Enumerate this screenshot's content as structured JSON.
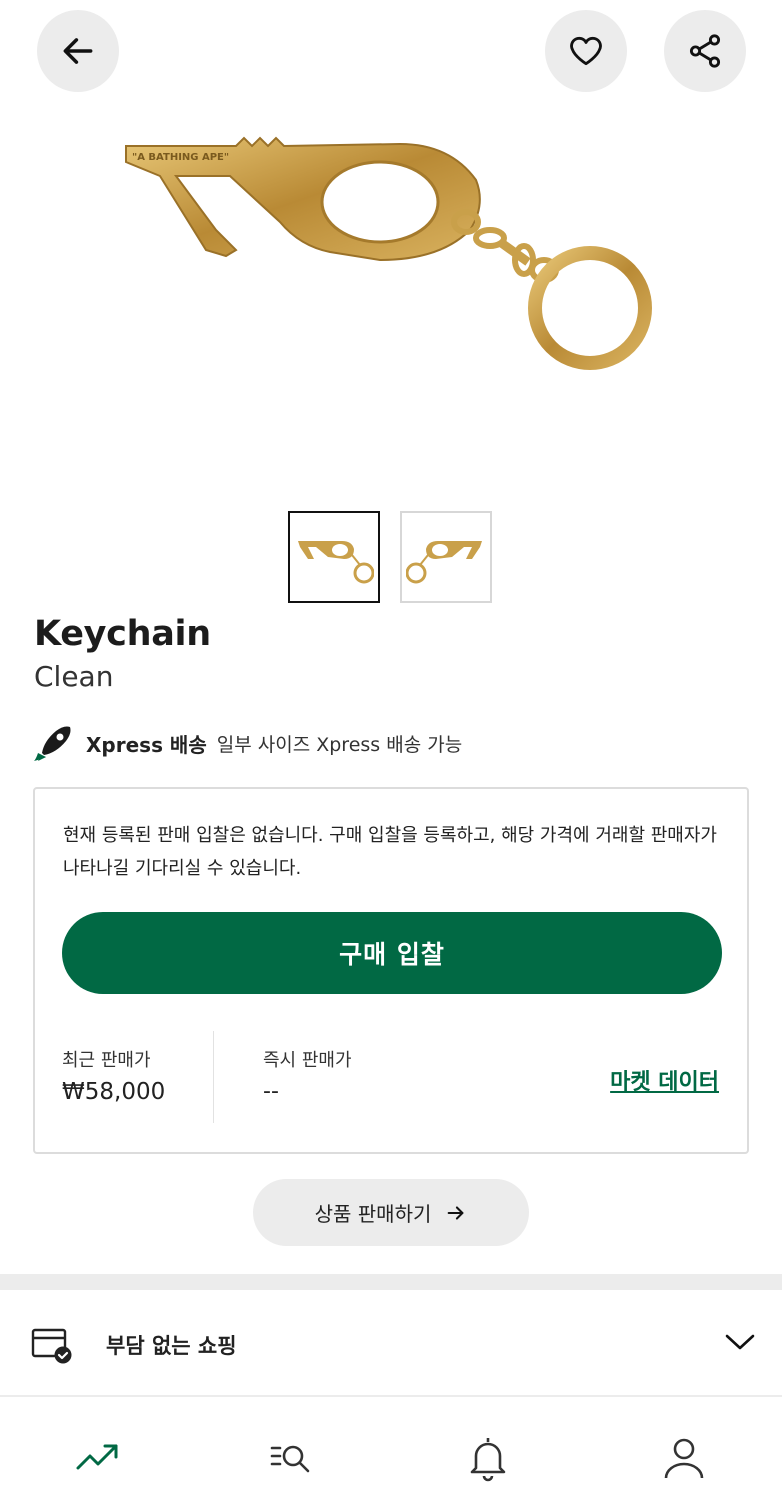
{
  "header": {
    "back_icon": "arrow-left-icon",
    "like_icon": "heart-icon",
    "share_icon": "share-icon"
  },
  "gallery": {
    "hero_brand_engraving": "A BATHING APE",
    "thumbnails": [
      "thumb-front",
      "thumb-back"
    ],
    "active_thumbnail": 0
  },
  "product": {
    "name": "Keychain",
    "subtitle": "Clean"
  },
  "xpress": {
    "icon": "rocket-icon",
    "label": "Xpress 배송",
    "description": "일부 사이즈 Xpress 배송 가능"
  },
  "bid_card": {
    "notice": "현재 등록된 판매 입찰은 없습니다. 구매 입찰을 등록하고, 해당 가격에 거래할 판매자가 나타나길 기다리실 수 있습니다.",
    "bid_button_label": "구매 입찰",
    "recent_price_label": "최근 판매가",
    "recent_price_value": "₩58,000",
    "instant_price_label": "즉시 판매가",
    "instant_price_value": "--",
    "market_data_link": "마켓 데이터"
  },
  "sell_button": {
    "label": "상품 판매하기",
    "icon": "arrow-right-icon"
  },
  "accordion": {
    "icon": "shopping-check-icon",
    "label": "부담 없는 쇼핑",
    "chevron": "chevron-down-icon"
  },
  "tabbar": {
    "items": [
      {
        "icon": "trending-icon",
        "active": true
      },
      {
        "icon": "search-menu-icon",
        "active": false
      },
      {
        "icon": "bell-icon",
        "active": false
      },
      {
        "icon": "person-icon",
        "active": false
      }
    ]
  },
  "colors": {
    "brand_green": "#016944",
    "button_grey": "#ececec",
    "gold": "#c9a04a"
  }
}
